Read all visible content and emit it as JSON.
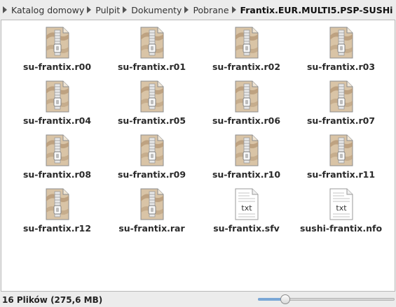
{
  "breadcrumb": {
    "items": [
      "Katalog domowy",
      "Pulpit",
      "Dokumenty",
      "Pobrane",
      "Frantix.EUR.MULTI5.PSP-SUSHi"
    ]
  },
  "files": [
    {
      "name": "su-frantix.r00",
      "icon": "archive-icon"
    },
    {
      "name": "su-frantix.r01",
      "icon": "archive-icon"
    },
    {
      "name": "su-frantix.r02",
      "icon": "archive-icon"
    },
    {
      "name": "su-frantix.r03",
      "icon": "archive-icon"
    },
    {
      "name": "su-frantix.r04",
      "icon": "archive-icon"
    },
    {
      "name": "su-frantix.r05",
      "icon": "archive-icon"
    },
    {
      "name": "su-frantix.r06",
      "icon": "archive-icon"
    },
    {
      "name": "su-frantix.r07",
      "icon": "archive-icon"
    },
    {
      "name": "su-frantix.r08",
      "icon": "archive-icon"
    },
    {
      "name": "su-frantix.r09",
      "icon": "archive-icon"
    },
    {
      "name": "su-frantix.r10",
      "icon": "archive-icon"
    },
    {
      "name": "su-frantix.r11",
      "icon": "archive-icon"
    },
    {
      "name": "su-frantix.r12",
      "icon": "archive-icon"
    },
    {
      "name": "su-frantix.rar",
      "icon": "archive-icon"
    },
    {
      "name": "su-frantix.sfv",
      "icon": "text-file-icon",
      "icon_text": "txt"
    },
    {
      "name": "sushi-frantix.nfo",
      "icon": "text-file-icon",
      "icon_text": "txt"
    }
  ],
  "status": {
    "text": "16 Plików (275,6 MB)",
    "zoom_level": 0.2
  },
  "colors": {
    "accent": "#7aa7d6",
    "archive_body": "#d9c4a6",
    "archive_shade": "#b79a78"
  }
}
